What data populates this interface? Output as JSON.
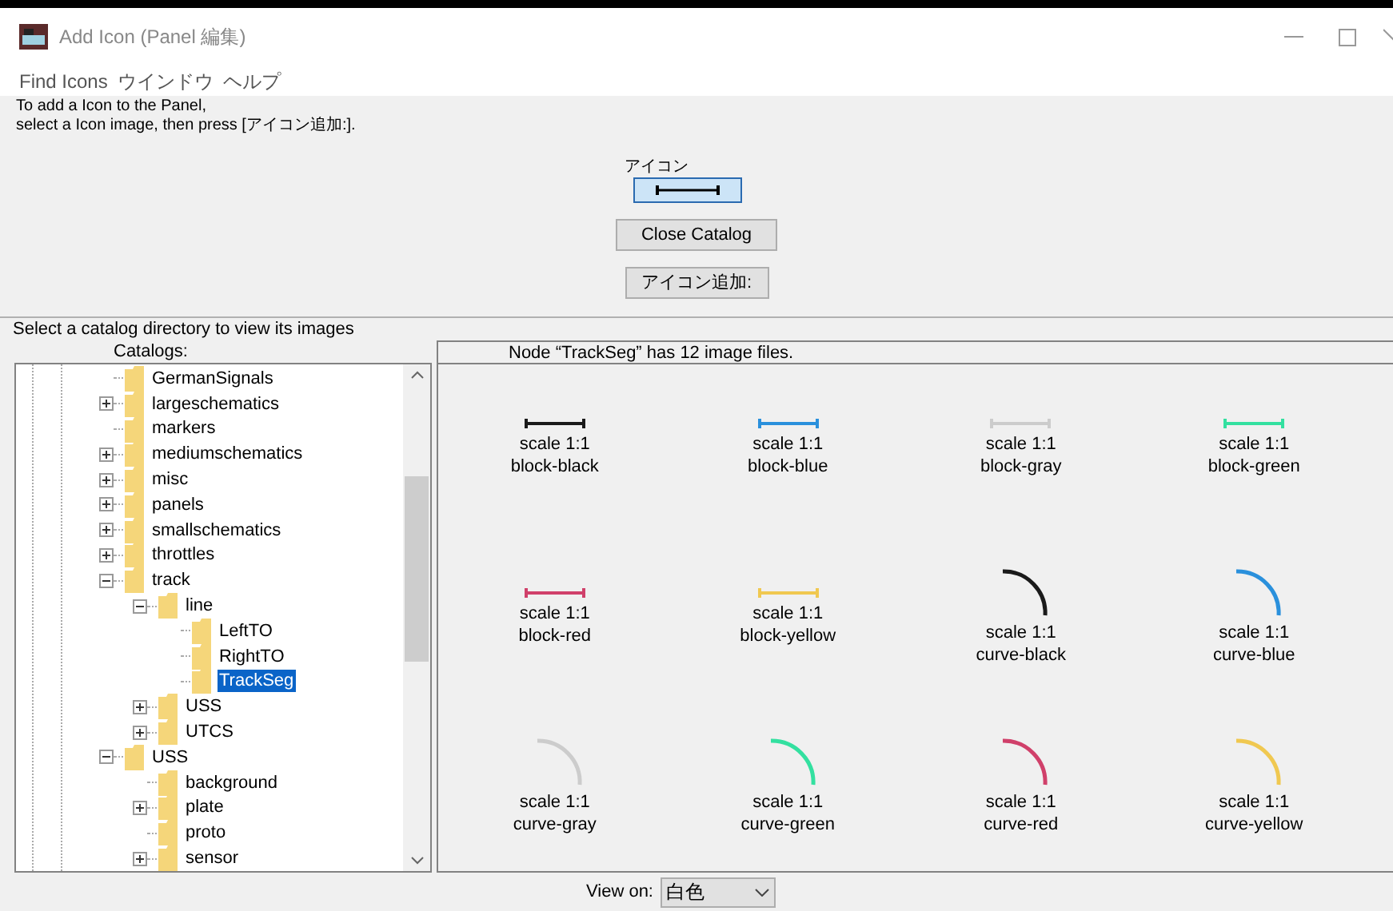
{
  "window": {
    "title": "Add Icon (Panel 編集)"
  },
  "menu": [
    "Find Icons",
    "ウインドウ",
    "ヘルプ"
  ],
  "instructions": [
    "To add a Icon to the Panel,",
    "select a Icon image, then press [アイコン追加:]."
  ],
  "preview": {
    "label": "アイコン"
  },
  "buttons": [
    "Close Catalog",
    "アイコン追加:"
  ],
  "catalog_hint": "Select a catalog directory to view its images",
  "tree": {
    "header": "Catalogs:",
    "items": [
      {
        "name": "GermanSignals",
        "expandable": false,
        "selected": false
      },
      {
        "name": "largeschematics",
        "expandable": true,
        "expanded": false,
        "selected": false
      },
      {
        "name": "markers",
        "expandable": false,
        "selected": false
      },
      {
        "name": "mediumschematics",
        "expandable": true,
        "expanded": false,
        "selected": false
      },
      {
        "name": "misc",
        "expandable": true,
        "expanded": false,
        "selected": false
      },
      {
        "name": "panels",
        "expandable": true,
        "expanded": false,
        "selected": false
      },
      {
        "name": "smallschematics",
        "expandable": true,
        "expanded": false,
        "selected": false
      },
      {
        "name": "throttles",
        "expandable": true,
        "expanded": false,
        "selected": false
      },
      {
        "name": "track",
        "expandable": true,
        "expanded": true,
        "selected": false,
        "children": [
          {
            "name": "line",
            "expandable": true,
            "expanded": true,
            "selected": false,
            "children": [
              {
                "name": "LeftTO",
                "expandable": false,
                "selected": false
              },
              {
                "name": "RightTO",
                "expandable": false,
                "selected": false
              },
              {
                "name": "TrackSeg",
                "expandable": false,
                "selected": true
              }
            ]
          },
          {
            "name": "USS",
            "expandable": true,
            "expanded": false,
            "selected": false
          },
          {
            "name": "UTCS",
            "expandable": true,
            "expanded": false,
            "selected": false
          }
        ]
      },
      {
        "name": "USS",
        "expandable": true,
        "expanded": true,
        "selected": false,
        "children": [
          {
            "name": "background",
            "expandable": false,
            "selected": false
          },
          {
            "name": "plate",
            "expandable": true,
            "expanded": false,
            "selected": false
          },
          {
            "name": "proto",
            "expandable": false,
            "selected": false
          },
          {
            "name": "sensor",
            "expandable": true,
            "expanded": false,
            "selected": false
          }
        ]
      }
    ]
  },
  "images": {
    "header": "Node “TrackSeg” has 12 image files.",
    "items": [
      {
        "kind": "block",
        "color": "#1a1a1a",
        "scale": "scale 1:1",
        "name": "block-black"
      },
      {
        "kind": "block",
        "color": "#2a90dc",
        "scale": "scale 1:1",
        "name": "block-blue"
      },
      {
        "kind": "block",
        "color": "#cccccc",
        "scale": "scale 1:1",
        "name": "block-gray"
      },
      {
        "kind": "block",
        "color": "#33e0a0",
        "scale": "scale 1:1",
        "name": "block-green"
      },
      {
        "kind": "block",
        "color": "#d0406a",
        "scale": "scale 1:1",
        "name": "block-red"
      },
      {
        "kind": "block",
        "color": "#f0c850",
        "scale": "scale 1:1",
        "name": "block-yellow"
      },
      {
        "kind": "curve",
        "color": "#1a1a1a",
        "scale": "scale 1:1",
        "name": "curve-black"
      },
      {
        "kind": "curve",
        "color": "#2a90dc",
        "scale": "scale 1:1",
        "name": "curve-blue"
      },
      {
        "kind": "curve",
        "color": "#cccccc",
        "scale": "scale 1:1",
        "name": "curve-gray"
      },
      {
        "kind": "curve",
        "color": "#33e0a0",
        "scale": "scale 1:1",
        "name": "curve-green"
      },
      {
        "kind": "curve",
        "color": "#d0406a",
        "scale": "scale 1:1",
        "name": "curve-red"
      },
      {
        "kind": "curve",
        "color": "#f0c850",
        "scale": "scale 1:1",
        "name": "curve-yellow"
      }
    ]
  },
  "view_on": {
    "label": "View on:",
    "value": "白色"
  }
}
